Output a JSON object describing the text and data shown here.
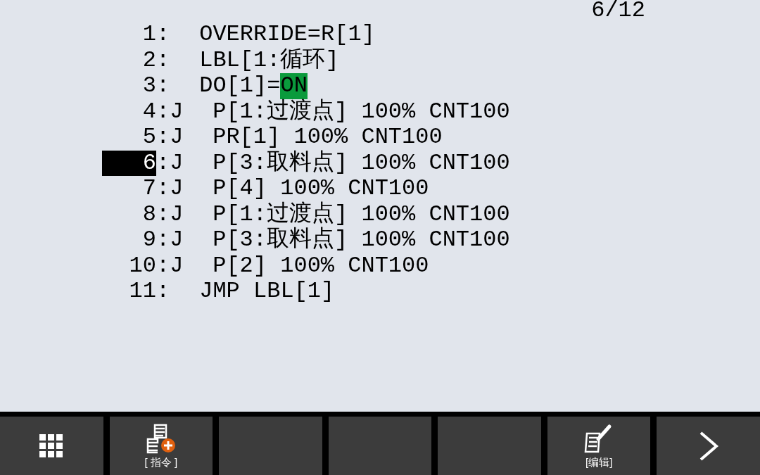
{
  "page_indicator": "6/12",
  "program_lines": [
    {
      "number": "1",
      "separator": ":",
      "selected": false,
      "segments": [
        {
          "text": "OVERRIDE=R[1]",
          "highlighted": false
        }
      ]
    },
    {
      "number": "2",
      "separator": ":",
      "selected": false,
      "segments": [
        {
          "text": "LBL[1:循环]",
          "highlighted": false
        }
      ]
    },
    {
      "number": "3",
      "separator": ":",
      "selected": false,
      "segments": [
        {
          "text": "DO[1]=",
          "highlighted": false
        },
        {
          "text": "ON",
          "highlighted": true
        }
      ]
    },
    {
      "number": "4",
      "separator": ":",
      "motion": "J",
      "selected": false,
      "segments": [
        {
          "text": "P[1:过渡点] 100% CNT100",
          "highlighted": false
        }
      ]
    },
    {
      "number": "5",
      "separator": ":",
      "motion": "J",
      "selected": false,
      "segments": [
        {
          "text": "PR[1] 100% CNT100",
          "highlighted": false
        }
      ]
    },
    {
      "number": "6",
      "separator": ":",
      "motion": "J",
      "selected": true,
      "segments": [
        {
          "text": "P[3:取料点] 100% CNT100",
          "highlighted": false
        }
      ]
    },
    {
      "number": "7",
      "separator": ":",
      "motion": "J",
      "selected": false,
      "segments": [
        {
          "text": "P[4] 100% CNT100",
          "highlighted": false
        }
      ]
    },
    {
      "number": "8",
      "separator": ":",
      "motion": "J",
      "selected": false,
      "segments": [
        {
          "text": "P[1:过渡点] 100% CNT100",
          "highlighted": false
        }
      ]
    },
    {
      "number": "9",
      "separator": ":",
      "motion": "J",
      "selected": false,
      "segments": [
        {
          "text": "P[3:取料点] 100% CNT100",
          "highlighted": false
        }
      ]
    },
    {
      "number": "10",
      "separator": ":",
      "motion": "J",
      "selected": false,
      "segments": [
        {
          "text": "P[2] 100% CNT100",
          "highlighted": false
        }
      ]
    },
    {
      "number": "11",
      "separator": ":",
      "selected": false,
      "segments": [
        {
          "text": "JMP LBL[1]",
          "highlighted": false
        }
      ]
    }
  ],
  "softkeys": [
    {
      "kind": "menu"
    },
    {
      "kind": "instruction",
      "label": "[ 指令 ]"
    },
    {
      "kind": "empty"
    },
    {
      "kind": "empty"
    },
    {
      "kind": "empty"
    },
    {
      "kind": "edit",
      "label": "[编辑]"
    },
    {
      "kind": "next"
    }
  ]
}
